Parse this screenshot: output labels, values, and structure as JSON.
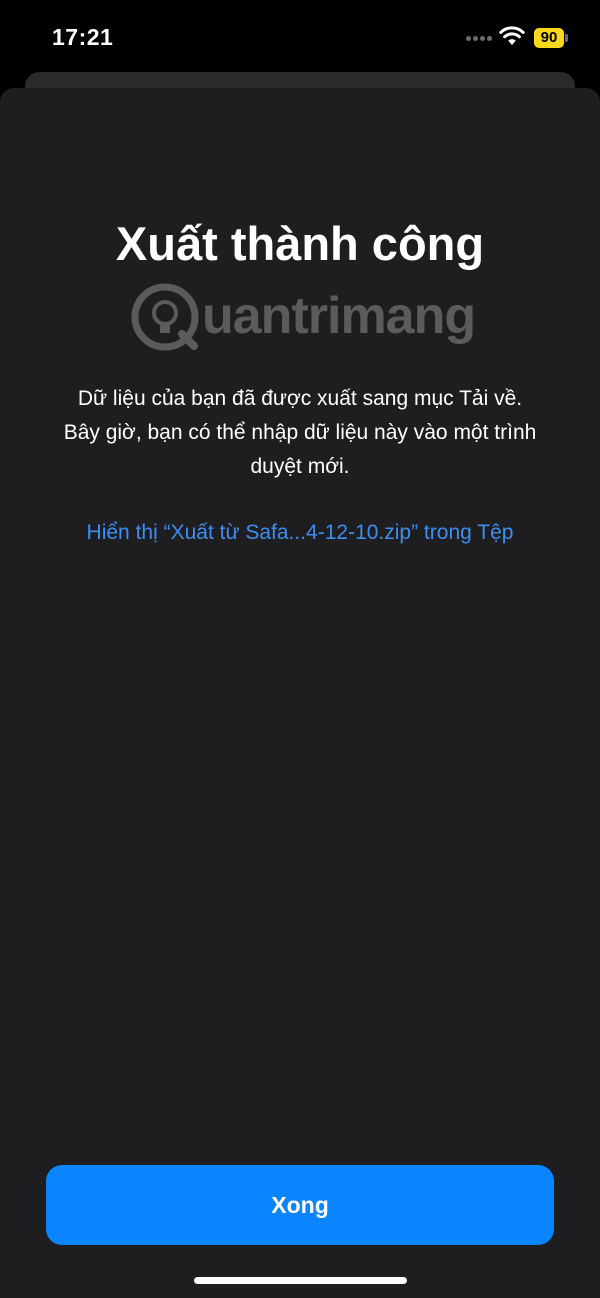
{
  "status_bar": {
    "time": "17:21",
    "battery_level": "90",
    "battery_color": "#f7d81a",
    "signal_icon": "signal-dots-icon",
    "wifi_icon": "wifi-icon"
  },
  "sheet": {
    "title": "Xuất thành công",
    "watermark_text": "uantrimang",
    "description": "Dữ liệu của bạn đã được xuất sang mục Tải về. Bây giờ, bạn có thể nhập dữ liệu này vào một trình duyệt mới.",
    "files_link": "Hiển thị “Xuất từ Safa...4-12-10.zip” trong Tệp",
    "done_button": "Xong"
  },
  "colors": {
    "accent": "#0a84ff",
    "link": "#3b8ff0",
    "sheet_background": "#1e1e20"
  }
}
